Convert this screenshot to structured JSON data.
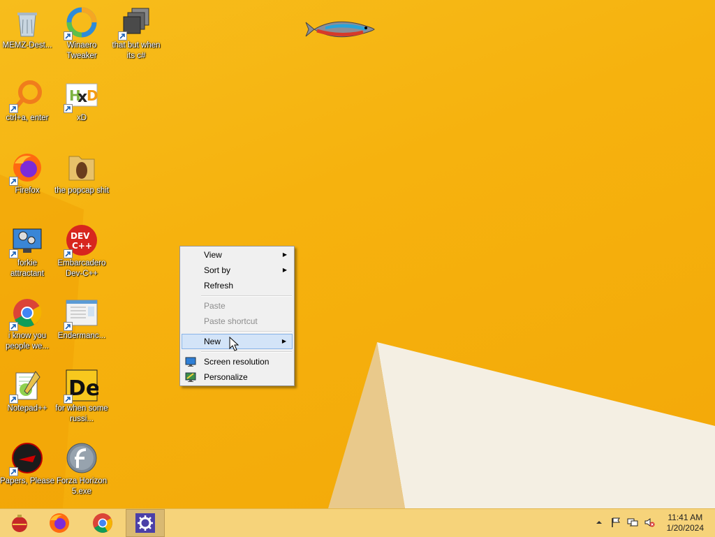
{
  "desktop": {
    "icons": [
      {
        "label": "MEMZ-Dest...",
        "icon": "recycle-bin-icon",
        "shortcut": false
      },
      {
        "label": "Winaero Tweaker",
        "icon": "winaero-tweaker-icon",
        "shortcut": true
      },
      {
        "label": "that but when its c#",
        "icon": "stacked-windows-icon",
        "shortcut": true
      },
      {
        "label": "ctrl+a, enter",
        "icon": "magnifier-ring-icon",
        "shortcut": true
      },
      {
        "label": "xD",
        "icon": "hxd-hex-editor-icon",
        "shortcut": true
      },
      {
        "label": "Firefox",
        "icon": "firefox-icon",
        "shortcut": true
      },
      {
        "label": "the popcap shit",
        "icon": "folder-icon",
        "shortcut": false
      },
      {
        "label": "forkie attractant",
        "icon": "monitor-gears-icon",
        "shortcut": true
      },
      {
        "label": "Embarcadero Dev-C++",
        "icon": "dev-cpp-icon",
        "shortcut": true
      },
      {
        "label": "i know you people we...",
        "icon": "chrome-icon",
        "shortcut": true
      },
      {
        "label": "Endermanc...",
        "icon": "document-window-icon",
        "shortcut": true
      },
      {
        "label": "Notepad++",
        "icon": "notepad-plus-plus-icon",
        "shortcut": true
      },
      {
        "label": "for when some russi...",
        "icon": "de-icon",
        "shortcut": true
      },
      {
        "label": "Papers, Please",
        "icon": "papers-please-icon",
        "shortcut": true
      },
      {
        "label": "Forza Horizon 5.exe",
        "icon": "flash-icon",
        "shortcut": false
      }
    ]
  },
  "context_menu": {
    "items": [
      {
        "label": "View",
        "submenu": true,
        "disabled": false
      },
      {
        "label": "Sort by",
        "submenu": true,
        "disabled": false
      },
      {
        "label": "Refresh",
        "submenu": false,
        "disabled": false
      },
      {
        "label": "Paste",
        "submenu": false,
        "disabled": true
      },
      {
        "label": "Paste shortcut",
        "submenu": false,
        "disabled": true
      },
      {
        "label": "New",
        "submenu": true,
        "disabled": false,
        "highlighted": true
      },
      {
        "label": "Screen resolution",
        "submenu": false,
        "disabled": false,
        "icon": "screen-resolution-icon"
      },
      {
        "label": "Personalize",
        "submenu": false,
        "disabled": false,
        "icon": "personalize-icon"
      }
    ],
    "highlight_color": "#d3e4f8"
  },
  "taskbar": {
    "apps": [
      {
        "icon": "ornament-start-icon"
      },
      {
        "icon": "firefox-icon"
      },
      {
        "icon": "chrome-icon"
      },
      {
        "icon": "settings-gear-icon",
        "active": true
      }
    ],
    "tray": [
      "show-hidden-icons-chevron",
      "action-center-flag-icon",
      "network-icon",
      "volume-muted-icon"
    ],
    "clock": {
      "time": "11:41 AM",
      "date": "1/20/2024"
    }
  },
  "colors": {
    "desktop_background": "#f6b20e",
    "taskbar": "#f6d37a"
  }
}
